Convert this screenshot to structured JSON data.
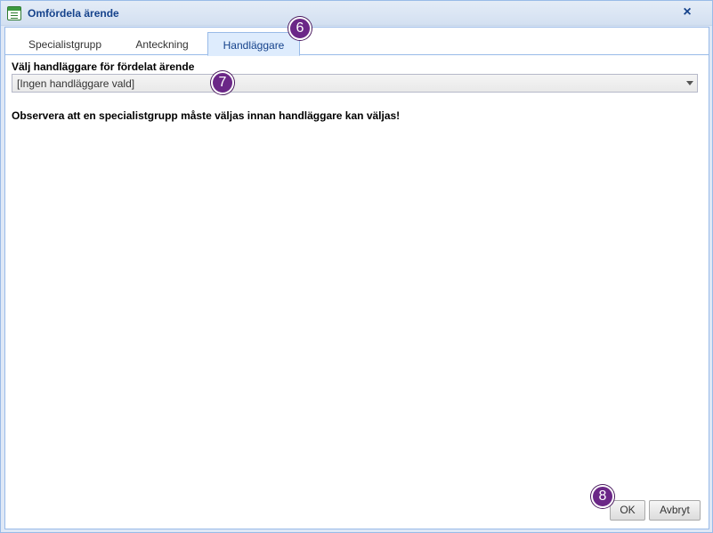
{
  "window": {
    "title": "Omfördela ärende",
    "close_label": "×"
  },
  "tabs": [
    {
      "label": "Specialistgrupp",
      "active": false
    },
    {
      "label": "Anteckning",
      "active": false
    },
    {
      "label": "Handläggare",
      "active": true
    }
  ],
  "form": {
    "field_label": "Välj handläggare för fördelat ärende",
    "selected_value": "[Ingen handläggare vald]",
    "notice": "Observera att en specialistgrupp måste väljas innan handläggare kan väljas!"
  },
  "buttons": {
    "ok_label": "OK",
    "cancel_label": "Avbryt"
  },
  "annotations": [
    "6",
    "7",
    "8"
  ],
  "colors": {
    "title_text": "#15428b",
    "panel_border": "#99bbe8",
    "active_tab": "#deecfd",
    "badge": "#6b2787"
  },
  "icons": {
    "title": "form-document-icon",
    "combo_trigger": "triangle-down-icon"
  }
}
